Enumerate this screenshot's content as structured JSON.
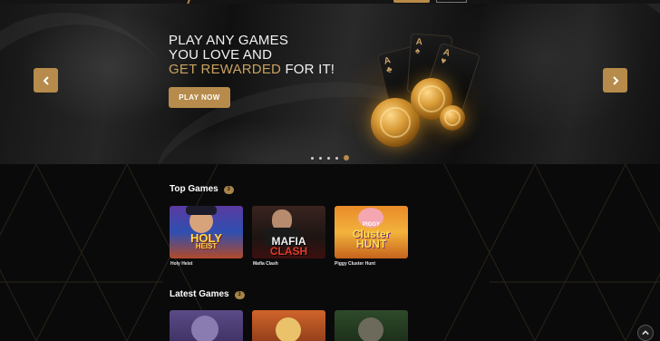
{
  "hero": {
    "line1": "PLAY ANY GAMES",
    "line2": "YOU LOVE AND",
    "line3_gold": "GET REWARDED",
    "line3_rest": " FOR IT!",
    "cta_label": "PLAY NOW",
    "slides": 5,
    "active_slide": 5
  },
  "sections": [
    {
      "title": "Top Games",
      "badge": "3",
      "games": [
        {
          "name": "Holy Heist",
          "logo_line1": "HOLY",
          "logo_line2": "HEIST"
        },
        {
          "name": "Mafia Clash",
          "logo_line1": "MAFIA",
          "logo_line2": "CLASH"
        },
        {
          "name": "Piggy Cluster Hunt",
          "logo_top": "PIGGY",
          "logo_line1": "Cluster",
          "logo_line2": "HUNT"
        }
      ]
    },
    {
      "title": "Latest Games",
      "badge": "3"
    }
  ],
  "colors": {
    "accent": "#b68b4c",
    "background": "#0b0b0b",
    "hero_gold_text": "#c9a15e"
  },
  "icons": [
    "chevron-left-icon",
    "chevron-right-icon",
    "chevron-up-icon"
  ]
}
